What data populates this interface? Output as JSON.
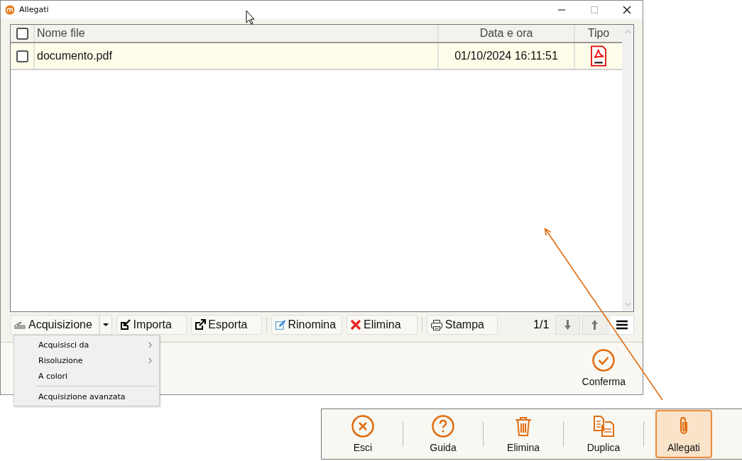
{
  "window": {
    "title": "Allegati"
  },
  "table": {
    "columns": [
      {
        "kind": "check",
        "checked": false
      },
      {
        "kind": "name",
        "label": "Nome file"
      },
      {
        "kind": "date",
        "label": "Data e ora"
      },
      {
        "kind": "type",
        "label": "Tipo"
      }
    ],
    "rows": [
      {
        "checked": false,
        "selected": true,
        "name": "documento.pdf",
        "datetime": "01/10/2024 16:11:51",
        "kind": "pdf"
      }
    ]
  },
  "toolbar": {
    "items": [
      {
        "kind": "scanner",
        "label": "Acquisizione",
        "dropdown": true
      },
      {
        "kind": "import",
        "label": "Importa"
      },
      {
        "kind": "export",
        "label": "Esporta"
      },
      {
        "kind": "separator"
      },
      {
        "kind": "rename",
        "label": "Rinomina"
      },
      {
        "kind": "delete",
        "label": "Elimina"
      },
      {
        "kind": "separator"
      },
      {
        "kind": "print",
        "label": "Stampa"
      }
    ],
    "pager": "1/1"
  },
  "menu": {
    "items": [
      {
        "label": "Acquisisci da",
        "submenu": true
      },
      {
        "label": "Risoluzione",
        "submenu": true
      },
      {
        "label": "A colori",
        "submenu": false
      },
      {
        "kind": "separator"
      },
      {
        "label": "Acquisizione avanzata",
        "submenu": false
      }
    ]
  },
  "confirm": {
    "label": "Conferma"
  },
  "bottom_toolbar": {
    "items": [
      {
        "kind": "exit",
        "label": "Esci",
        "selected": false
      },
      {
        "kind": "help",
        "label": "Guida",
        "selected": false
      },
      {
        "kind": "trash",
        "label": "Elimina",
        "selected": false
      },
      {
        "kind": "duplicate",
        "label": "Duplica",
        "selected": false
      },
      {
        "kind": "clip",
        "label": "Allegati",
        "selected": true
      }
    ]
  }
}
